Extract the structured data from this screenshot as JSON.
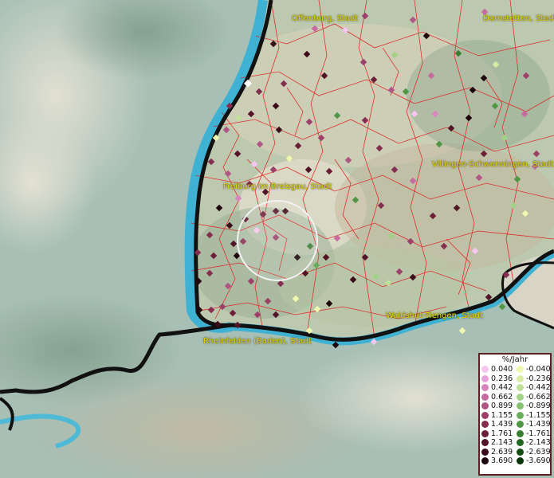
{
  "map": {
    "cities": [
      {
        "name": "Offenburg, Stadt"
      },
      {
        "name": "Dornstetten, Stadt"
      },
      {
        "name": "Villingen-Schwenningen, Stadt"
      },
      {
        "name": "Freiburg im Breisgau, Stadt"
      },
      {
        "name": "Waldshut-Tiengen, Stadt"
      },
      {
        "name": "Rheinfelden (Baden), Stadt"
      }
    ],
    "colors": {
      "water": "#3fb2d4",
      "border": "#111111",
      "municipal_lines": "#e02020",
      "selection_ring": "#f2f2f2"
    }
  },
  "legend": {
    "title": "%/Jahr",
    "rows": [
      {
        "pos": "0.040",
        "pos_color": "#f5c6ef",
        "neg": "-0.040",
        "neg_color": "#f0f8b0"
      },
      {
        "pos": "0.236",
        "pos_color": "#e8a0d8",
        "neg": "-0.236",
        "neg_color": "#d8eca4"
      },
      {
        "pos": "0.442",
        "pos_color": "#d884bd",
        "neg": "-0.442",
        "neg_color": "#bfe098"
      },
      {
        "pos": "0.662",
        "pos_color": "#c66aa0",
        "neg": "-0.662",
        "neg_color": "#a2d286"
      },
      {
        "pos": "0.899",
        "pos_color": "#b05584",
        "neg": "-0.899",
        "neg_color": "#86c272"
      },
      {
        "pos": "1.155",
        "pos_color": "#9c4069",
        "neg": "-1.155",
        "neg_color": "#6aae5c"
      },
      {
        "pos": "1.439",
        "pos_color": "#852e50",
        "neg": "-1.439",
        "neg_color": "#4f9744"
      },
      {
        "pos": "1.761",
        "pos_color": "#6d1f3a",
        "neg": "-1.761",
        "neg_color": "#377e30"
      },
      {
        "pos": "2.143",
        "pos_color": "#541428",
        "neg": "-2.143",
        "neg_color": "#22661f"
      },
      {
        "pos": "2.639",
        "pos_color": "#3b0b19",
        "neg": "-2.639",
        "neg_color": "#124e12"
      },
      {
        "pos": "3.690",
        "pos_color": "#1e040b",
        "neg": "-3.690",
        "neg_color": "#053605"
      }
    ]
  }
}
